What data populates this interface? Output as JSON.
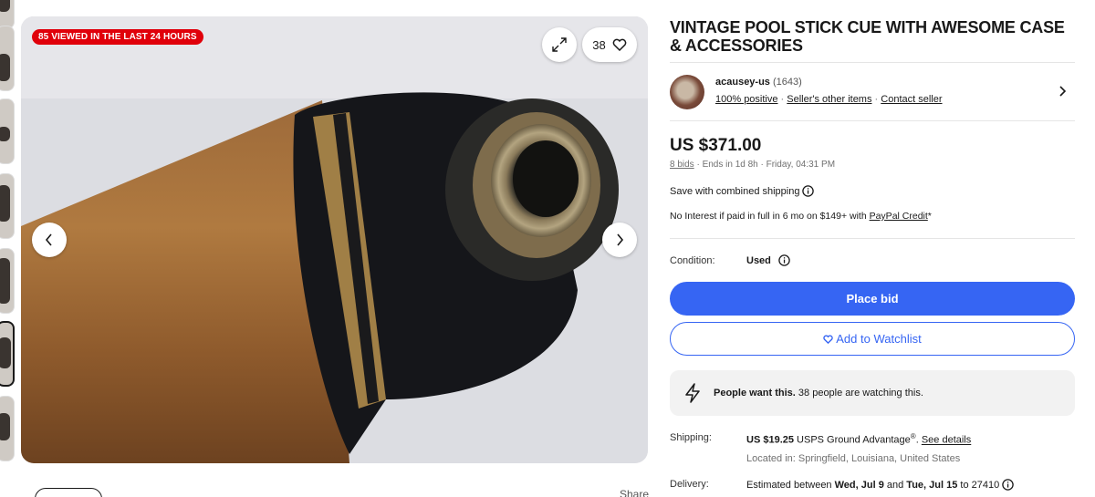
{
  "gallery": {
    "badge": "85 VIEWED IN THE LAST 24 HOURS",
    "watch_count": "38",
    "share_label": "Share"
  },
  "listing": {
    "title": "VINTAGE POOL STICK CUE WITH AWESOME CASE & ACCESSORIES"
  },
  "seller": {
    "name": "acausey-us",
    "feedback": "(1643)",
    "positive": "100% positive",
    "other_items": "Seller's other items",
    "contact": "Contact seller",
    "sep": " · "
  },
  "price": {
    "amount": "US $371.00",
    "bids": "8 bids",
    "ends": " · Ends in 1d 8h · Friday, 04:31 PM",
    "save_shipping": "Save with combined shipping",
    "no_interest_prefix": "No Interest if paid in full in 6 mo on $149+ with ",
    "paypal_credit": "PayPal Credit",
    "asterisk": "*"
  },
  "condition": {
    "label": "Condition:",
    "value": "Used"
  },
  "actions": {
    "place_bid": "Place bid",
    "add_watchlist": "Add to Watchlist"
  },
  "signal": {
    "bold": "People want this.",
    "text": " 38 people are watching this."
  },
  "shipping": {
    "label": "Shipping:",
    "cost": "US $19.25",
    "service": " USPS Ground Advantage",
    "reg": "®",
    "see_details": "See details",
    "location": "Located in: Springfield, Louisiana, United States"
  },
  "delivery": {
    "label": "Delivery:",
    "prefix": "Estimated between ",
    "date1": "Wed, Jul 9",
    "and": " and ",
    "date2": "Tue, Jul 15",
    "suffix": " to 27410"
  },
  "colors": {
    "primary": "#3665f3",
    "badge": "#e0000a"
  }
}
